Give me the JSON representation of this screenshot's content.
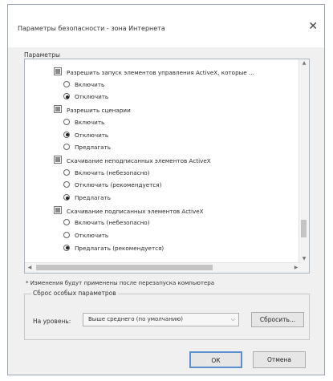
{
  "window": {
    "title": "Параметры безопасности - зона Интернета",
    "close_glyph": "✕"
  },
  "settings": {
    "label": "Параметры",
    "rows": [
      {
        "type": "check",
        "text": "Разрешить запуск элементов управления ActiveX, которые ..."
      },
      {
        "type": "radio",
        "checked": false,
        "text": "Включить"
      },
      {
        "type": "radio",
        "checked": true,
        "text": "Отключить"
      },
      {
        "type": "check",
        "text": "Разрешить сценарии"
      },
      {
        "type": "radio",
        "checked": false,
        "text": "Включить"
      },
      {
        "type": "radio",
        "checked": true,
        "text": "Отключить"
      },
      {
        "type": "radio",
        "checked": false,
        "text": "Предлагать"
      },
      {
        "type": "check",
        "text": "Скачивание неподписанных элементов ActiveX"
      },
      {
        "type": "radio",
        "checked": false,
        "text": "Включить (небезопасно)"
      },
      {
        "type": "radio",
        "checked": false,
        "text": "Отключить (рекомендуется)"
      },
      {
        "type": "radio",
        "checked": true,
        "text": "Предлагать"
      },
      {
        "type": "check",
        "text": "Скачивание подписанных элементов ActiveX"
      },
      {
        "type": "radio",
        "checked": false,
        "text": "Включить (небезопасно)"
      },
      {
        "type": "radio",
        "checked": false,
        "text": "Отключить"
      },
      {
        "type": "radio",
        "checked": true,
        "text": "Предлагать (рекомендуется)"
      }
    ]
  },
  "note": "* Изменения будут применены после перезапуска компьютера",
  "reset": {
    "group_label": "Сброс особых параметров",
    "level_label": "На уровень:",
    "level_value": "Выше среднего (по умолчанию)",
    "reset_button": "Сбросить..."
  },
  "buttons": {
    "ok": "ОК",
    "cancel": "Отмена"
  }
}
